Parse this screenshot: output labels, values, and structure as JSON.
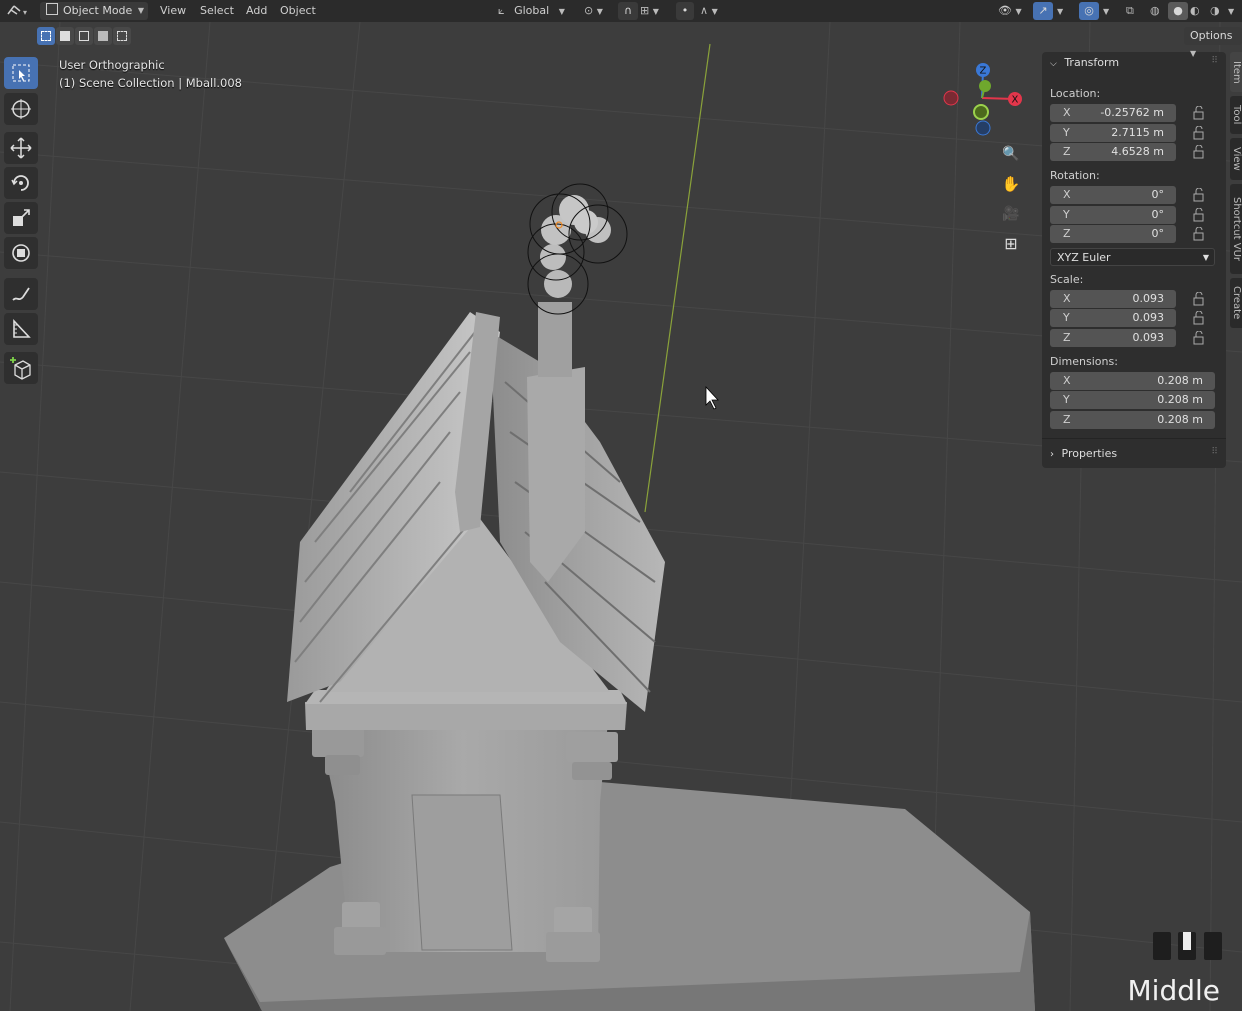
{
  "header": {
    "mode": "Object Mode",
    "menu": [
      "View",
      "Select",
      "Add",
      "Object"
    ],
    "orientation": "Global",
    "options_label": "Options"
  },
  "viewport": {
    "view_name": "User Orthographic",
    "collection_info": "(1) Scene Collection | Mball.008",
    "gizmo": {
      "x": "X",
      "y": "Y",
      "z": "Z"
    }
  },
  "npanel": {
    "transform_title": "Transform",
    "location_label": "Location:",
    "location": [
      {
        "axis": "X",
        "value": "-0.25762 m"
      },
      {
        "axis": "Y",
        "value": "2.7115 m"
      },
      {
        "axis": "Z",
        "value": "4.6528 m"
      }
    ],
    "rotation_label": "Rotation:",
    "rotation": [
      {
        "axis": "X",
        "value": "0°"
      },
      {
        "axis": "Y",
        "value": "0°"
      },
      {
        "axis": "Z",
        "value": "0°"
      }
    ],
    "rotation_mode": "XYZ Euler",
    "scale_label": "Scale:",
    "scale": [
      {
        "axis": "X",
        "value": "0.093"
      },
      {
        "axis": "Y",
        "value": "0.093"
      },
      {
        "axis": "Z",
        "value": "0.093"
      }
    ],
    "dimensions_label": "Dimensions:",
    "dimensions": [
      {
        "axis": "X",
        "value": "0.208 m"
      },
      {
        "axis": "Y",
        "value": "0.208 m"
      },
      {
        "axis": "Z",
        "value": "0.208 m"
      }
    ],
    "properties_title": "Properties"
  },
  "side_tabs": [
    "Item",
    "Tool",
    "View",
    "Shortcut VUr",
    "Create"
  ],
  "overlay": {
    "mouse_button": "Middle"
  },
  "colors": {
    "accent": "#4772b3",
    "x_axis": "#e3364b",
    "y_axis": "#6fa82d",
    "z_axis": "#3a78d6",
    "bg": "#3d3d3d"
  }
}
